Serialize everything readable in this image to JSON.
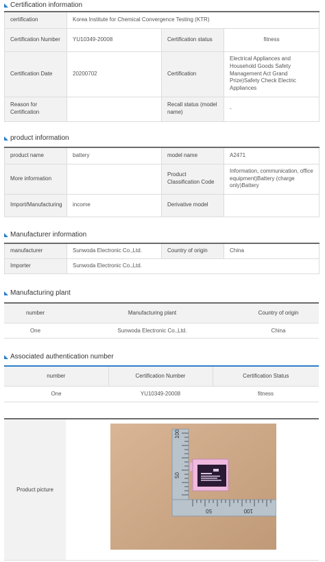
{
  "certification_info": {
    "title": "Certification information",
    "rows": {
      "certification_label": "certification",
      "certification_value": "Korea Institute for Chemical Convergence Testing (KTR)",
      "number_label": "Certification Number",
      "number_value": "YU10349-20008",
      "status_label": "Certification status",
      "status_value": "fitness",
      "date_label": "Certification Date",
      "date_value": "20200702",
      "cert_label": "Certification",
      "cert_value": "Electrical Appliances and Household Goods Safety Management Act Grand Prize)Safety Check Electric Appliances",
      "reason_label": "Reason for Certification",
      "reason_value": "",
      "recall_label": "Recall status (model name)",
      "recall_value": "-"
    }
  },
  "product_info": {
    "title": "product information",
    "rows": {
      "name_label": "product name",
      "name_value": "battery",
      "model_label": "model name",
      "model_value": "A2471",
      "more_label": "More information",
      "more_value": "",
      "class_label": "Product Classification Code",
      "class_value": "Information, communication, office equipment)Battery (charge only)Battery",
      "import_label": "Import/Manufacturing",
      "import_value": "income",
      "deriv_label": "Derivative model",
      "deriv_value": ""
    }
  },
  "manufacturer_info": {
    "title": "Manufacturer information",
    "rows": {
      "manufacturer_label": "manufacturer",
      "manufacturer_value": "Sunwoda Electronic Co.,Ltd.",
      "origin_label": "Country of origin",
      "origin_value": "China",
      "importer_label": "Importer",
      "importer_value": "Sunwoda Electronic Co.,Ltd."
    }
  },
  "manufacturing_plant": {
    "title": "Manufacturing plant",
    "headers": [
      "number",
      "Manufacturing plant",
      "Country of origin"
    ],
    "rows": [
      [
        "One",
        "Sunwoda Electronic Co.,Ltd.",
        "China"
      ]
    ]
  },
  "associated_auth": {
    "title": "Associated authentication number",
    "headers": [
      "number",
      "Certification Number",
      "Certification Status"
    ],
    "rows": [
      [
        "One",
        "YU10349-20008",
        "fitness"
      ]
    ]
  },
  "product_picture": {
    "label": "Product picture",
    "ruler_top": "100",
    "ruler_mid": "50",
    "ruler_bottom_a": "50",
    "ruler_bottom_b": "100"
  },
  "colors": {
    "accent": "#2a7fc9",
    "link": "#3c4fb0",
    "header_bg": "#f2f2f2"
  }
}
